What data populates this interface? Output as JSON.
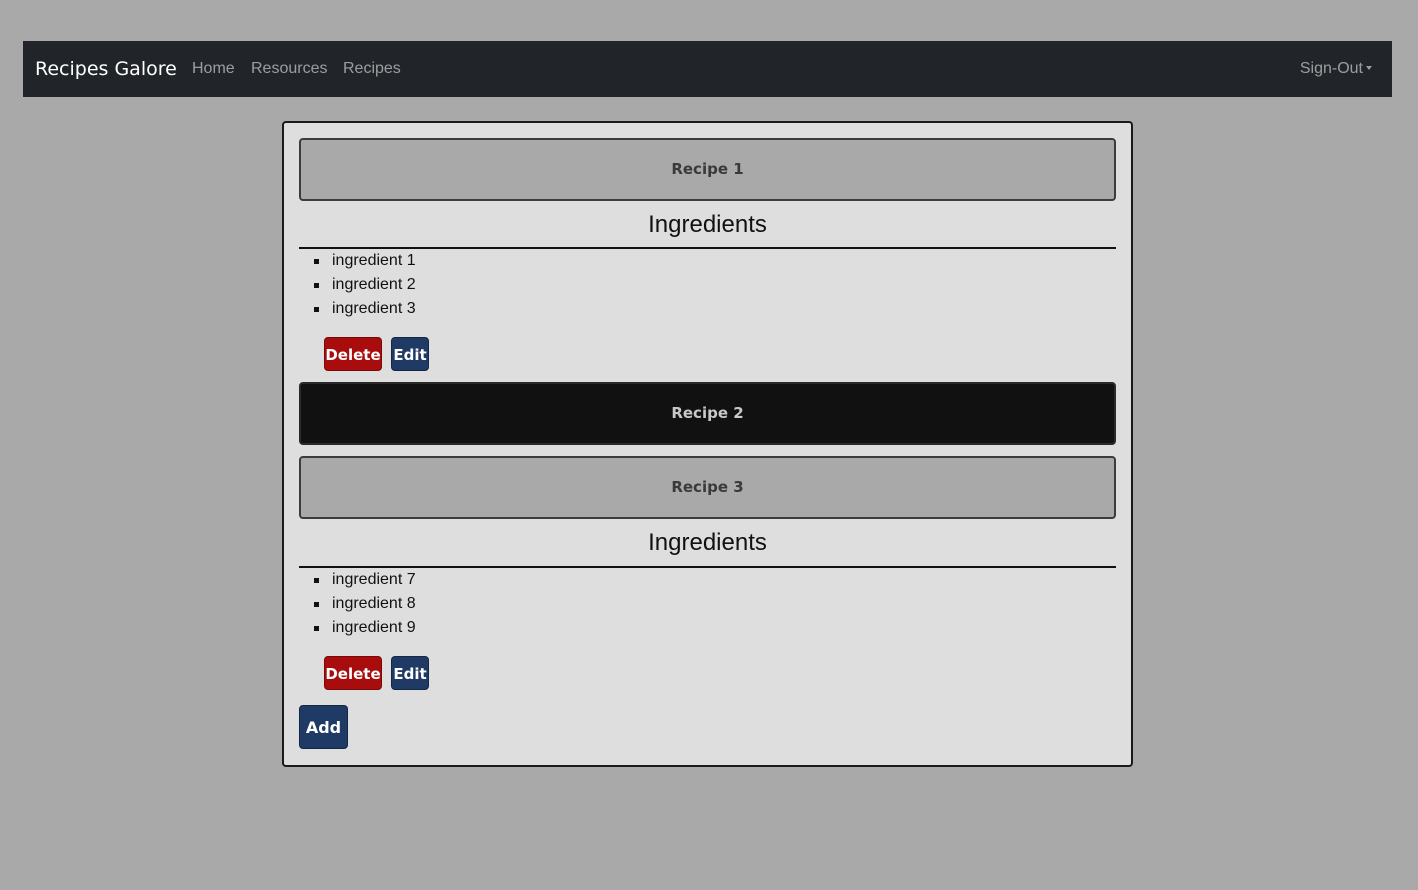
{
  "navbar": {
    "brand": "Recipes Galore",
    "links": [
      "Home",
      "Resources",
      "Recipes"
    ],
    "account_menu": "Sign-Out"
  },
  "recipes": [
    {
      "title": "Recipe 1",
      "expanded": true,
      "ingredients_heading": "Ingredients",
      "ingredients": [
        "ingredient 1",
        "ingredient 2",
        "ingredient 3"
      ],
      "delete_label": "Delete",
      "edit_label": "Edit"
    },
    {
      "title": "Recipe 2",
      "expanded": false
    },
    {
      "title": "Recipe 3",
      "expanded": true,
      "ingredients_heading": "Ingredients",
      "ingredients": [
        "ingredient 7",
        "ingredient 8",
        "ingredient 9"
      ],
      "delete_label": "Delete",
      "edit_label": "Edit"
    }
  ],
  "add_label": "Add",
  "colors": {
    "navbar_bg": "#212529",
    "page_bg": "#a9a9a9",
    "panel_bg": "#dedede",
    "delete_button": "#a80c0c",
    "primary_button": "#1f3a64",
    "hovered_recipe_bar": "#111111"
  }
}
